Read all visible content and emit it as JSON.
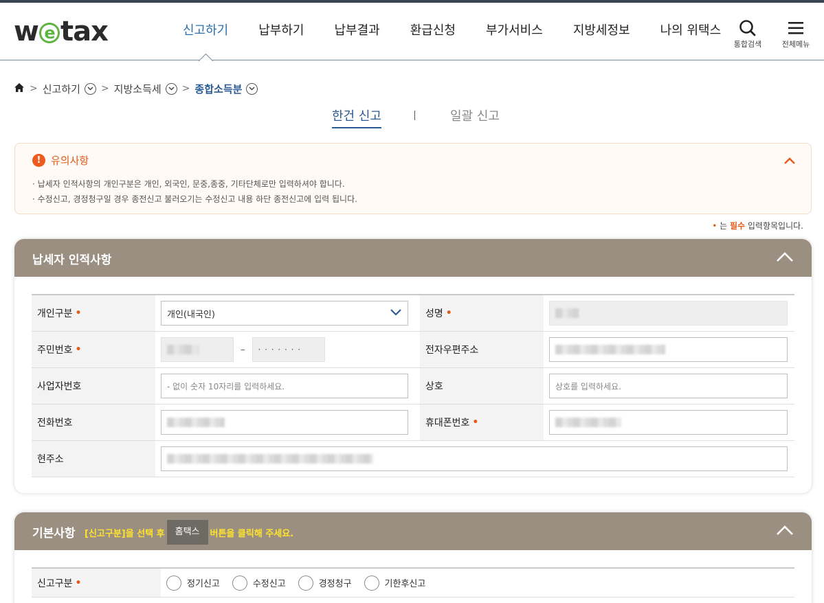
{
  "header": {
    "logo": {
      "pre": "w",
      "circle": "e",
      "post": "tax"
    },
    "nav": [
      "신고하기",
      "납부하기",
      "납부결과",
      "환급신청",
      "부가서비스",
      "지방세정보",
      "나의 위택스"
    ],
    "search_label": "통합검색",
    "menu_label": "전체메뉴"
  },
  "breadcrumb": {
    "items": [
      "신고하기",
      "지방소득세",
      "종합소득분"
    ]
  },
  "tabs": {
    "single": "한건 신고",
    "bulk": "일괄 신고"
  },
  "notice": {
    "title": "유의사항",
    "lines": [
      "· 납세자 인적사항의 개인구분은 개인, 외국인, 문중,종중, 기타단체로만 입력하셔야 합니다.",
      "· 수정신고, 경정청구일 경우 종전신고 불러오기는 수정신고 내용 하단 종전신고에 입력 됩니다."
    ]
  },
  "required_note": {
    "dot": "•",
    "pre": "는 ",
    "emph": "필수",
    "post": " 입력항목입니다."
  },
  "taxpayer": {
    "title": "납세자 인적사항",
    "labels": {
      "type": "개인구분",
      "name": "성명",
      "rrn": "주민번호",
      "email": "전자우편주소",
      "bizno": "사업자번호",
      "company": "상호",
      "phone": "전화번호",
      "mobile": "휴대폰번호",
      "address": "현주소"
    },
    "type_value": "개인(내국인)",
    "rrn_dash": "–",
    "rrn_masked": "· · · · · · ·",
    "bizno_placeholder": "- 없이 숫자 10자리를 입력하세요.",
    "company_placeholder": "상호를 입력하세요."
  },
  "basic": {
    "title": "기본사항",
    "guide_pre": "[신고구분]을 선택 후",
    "hometax": "홈택스",
    "guide_post": "버튼을 클릭해 주세요.",
    "label_type": "신고구분",
    "options": [
      "정기신고",
      "수정신고",
      "경정청구",
      "기한후신고"
    ]
  },
  "colors": {
    "accent": "#2a6fb0",
    "panel_header": "#9a8f80",
    "required": "#e35a1b",
    "guide": "#ffe22e"
  }
}
